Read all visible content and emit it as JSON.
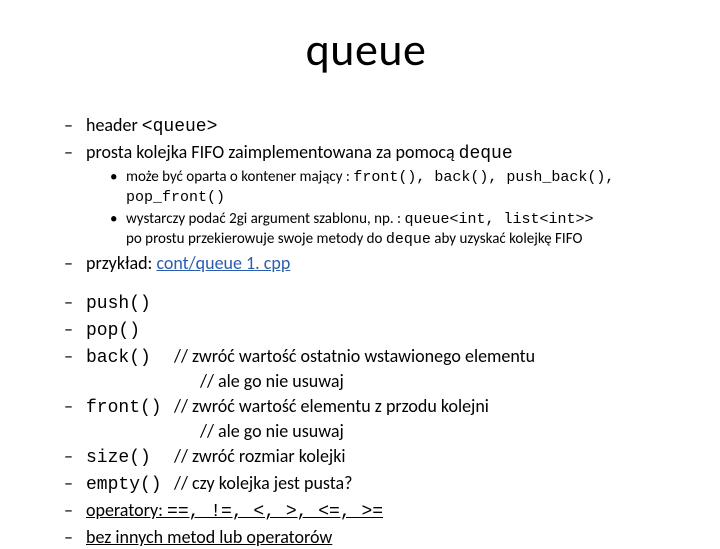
{
  "title": "queue",
  "b1": {
    "header_pre": "header ",
    "header_code": "<queue>",
    "fifo_pre": "prosta kolejka FIFO zaimplementowana za pomocą ",
    "fifo_code": "deque",
    "sub1_pre": "może być oparta o kontener mający : ",
    "sub1_code": "front(), back(), push_back(), pop_front()",
    "sub2_pre": "wystarczy podać 2gi argument szablonu, np. : ",
    "sub2_code": "queue<int, list<int>>",
    "sub2_line2_pre": "po prostu przekierowuje swoje metody do ",
    "sub2_line2_code": "deque",
    "sub2_line2_post": " aby uzyskać kolejkę FIFO",
    "example_pre": "przykład: ",
    "example_link": "cont/queue 1. cpp"
  },
  "methods": {
    "push": "push()",
    "pop": "pop()",
    "back": "back()",
    "back_c1": "// zwróć wartość ostatnio wstawionego elementu",
    "back_c2": "// ale go nie usuwaj",
    "front": "front()",
    "front_c1": "// zwróć wartość elementu z przodu kolejni",
    "front_c2": "// ale go nie usuwaj",
    "size": "size()",
    "size_c": "// zwróć rozmiar kolejki",
    "empty": "empty()",
    "empty_c": "// czy kolejka jest pusta?"
  },
  "ops_pre": "operatory: ",
  "ops_code": "==, !=, <, >, <=, >=",
  "nomore": "bez innych metod lub operatorów"
}
